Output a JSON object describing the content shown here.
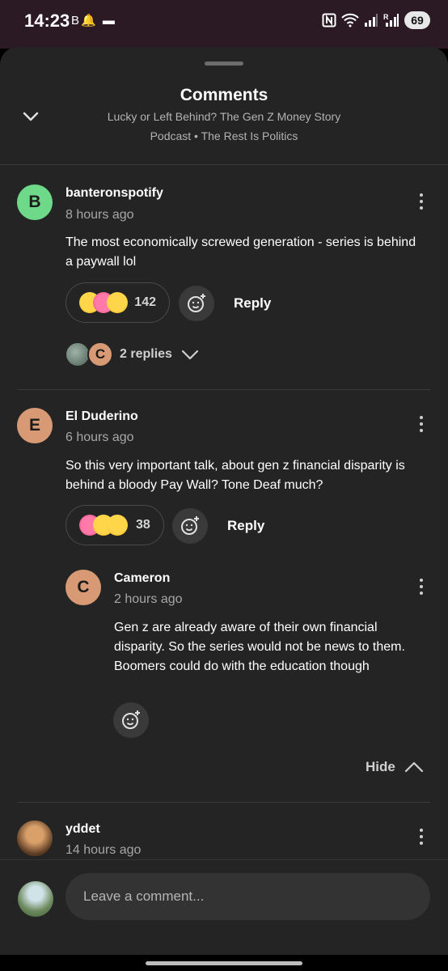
{
  "status_bar": {
    "time": "14:23",
    "left_icons": "B🔔 ▬",
    "battery": "69",
    "icons": [
      "nfc-icon",
      "wifi-icon",
      "signal-icon",
      "signal-r-icon"
    ]
  },
  "sheet": {
    "title": "Comments",
    "subtitle_line1": "Lucky or Left Behind? The Gen Z Money Story",
    "subtitle_line2": "Podcast • The Rest Is Politics"
  },
  "comments": [
    {
      "avatar_letter": "B",
      "avatar_color": "#6fd98a",
      "author": "banteronspotify",
      "time": "8 hours ago",
      "text": "The most economically screwed generation - series is behind a paywall lol",
      "reaction_count": "142",
      "reply_label": "Reply",
      "replies_label": "2 replies"
    },
    {
      "avatar_letter": "E",
      "avatar_color": "#d79a74",
      "author": "El Duderino",
      "time": "6 hours ago",
      "text": "So this very important talk, about gen z financial disparity is behind a bloody Pay Wall?  Tone Deaf much?",
      "reaction_count": "38",
      "reply_label": "Reply",
      "reply": {
        "avatar_letter": "C",
        "avatar_color": "#d79a74",
        "author": "Cameron",
        "time": "2 hours ago",
        "text": "Gen z are already aware of their own financial disparity. So the series would not be news to them. Boomers could do with the education though"
      },
      "hide_label": "Hide"
    },
    {
      "author": "yddet",
      "time": "14 hours ago"
    }
  ],
  "composer": {
    "placeholder": "Leave a comment..."
  },
  "colors": {
    "sheet_bg": "#242424",
    "status_bg": "#2b1a24",
    "muted_text": "#a7a7a7"
  }
}
